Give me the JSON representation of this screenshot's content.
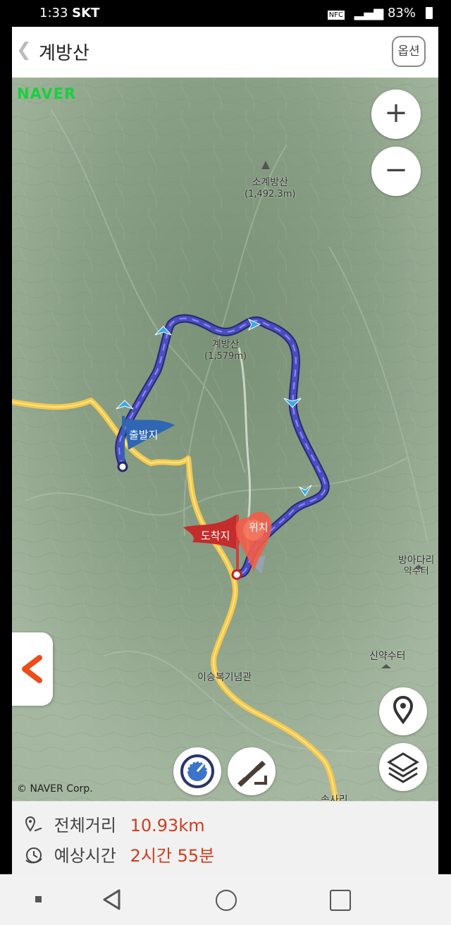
{
  "status_bar": {
    "time": "1:33",
    "carrier": "SKT",
    "nfc": "NFC",
    "battery": "83%"
  },
  "header": {
    "back_label": "❮",
    "title": "계방산",
    "options_label": "옵션"
  },
  "map": {
    "brand": "NAVER",
    "copyright": "© NAVER Corp.",
    "zoom_in": "+",
    "zoom_out": "−",
    "labels": {
      "peak_small_name": "소계방산",
      "peak_small_elevation": "(1,492.3m)",
      "peak_main_name": "계방산",
      "peak_main_elevation": "(1,579m)",
      "spring_1_line1": "방아다리",
      "spring_1_line2": "약수터",
      "spring_2": "신약수터",
      "memorial": "이승복기념관",
      "village": "속사리",
      "current_location_short": "위치"
    },
    "flags": {
      "start": "출발지",
      "end": "도착지"
    }
  },
  "summary": {
    "distance_label": "전체거리",
    "distance_value": "10.93km",
    "time_label": "예상시간",
    "time_value": "2시간 55분"
  },
  "colors": {
    "route": "#3b3fb5",
    "road": "#f6c84a",
    "start_flag": "#2f67b2",
    "end_flag": "#c32d2b",
    "accent": "#d23b1d"
  }
}
